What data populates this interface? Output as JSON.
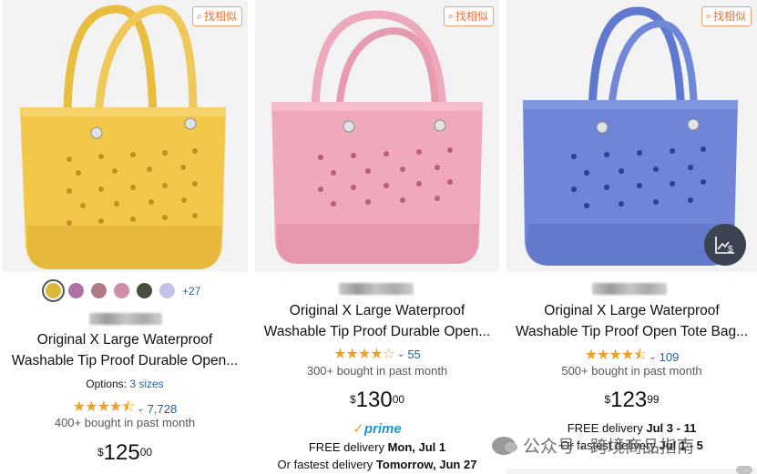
{
  "find_similar_label": "找相似",
  "products": [
    {
      "title_line1": "Original X Large Waterproof",
      "title_line2": "Washable Tip Proof Durable Open...",
      "options_prefix": "Options: ",
      "options_link": "3 sizes",
      "swatch_colors": [
        "#d9b93a",
        "#b071a7",
        "#b07a85",
        "#d48bab",
        "#4a4d3e",
        "#c3c2e8"
      ],
      "swatch_more": "+27",
      "rating_count": "7,728",
      "bought": "400+ bought in past month",
      "price_symbol": "$",
      "price_whole": "125",
      "price_cents": "00",
      "bag_color": "#f2c84b"
    },
    {
      "title_line1": "Original X Large Waterproof",
      "title_line2": "Washable Tip Proof Durable Open...",
      "rating_count": "55",
      "bought": "300+ bought in past month",
      "price_symbol": "$",
      "price_whole": "130",
      "price_cents": "00",
      "prime_label": "prime",
      "delivery_prefix": "FREE delivery ",
      "delivery_date": "Mon, Jul 1",
      "fastest_prefix": "Or fastest delivery ",
      "fastest_date": "Tomorrow, Jun 27",
      "bag_color": "#f0a8bd"
    },
    {
      "title_line1": "Original X Large Waterproof",
      "title_line2": "Washable Tip Proof Open Tote Bag...",
      "rating_count": "109",
      "bought": "500+ bought in past month",
      "price_symbol": "$",
      "price_whole": "123",
      "price_cents": "99",
      "delivery_prefix": "FREE delivery ",
      "delivery_date": "Jul 3 - 11",
      "fastest_prefix": "Or fastest delivery ",
      "fastest_date": "Jul 1 - 5",
      "bag_color": "#6f86d8"
    }
  ],
  "watermark_text": "公众号 · 跨境商品指南",
  "icons": [
    "search-icon",
    "trend-chart-icon",
    "wechat-icon",
    "star-icon",
    "chevron-down-icon"
  ],
  "colors": {
    "link": "#2162a1",
    "star": "#f0a028",
    "prime": "#1a98d5",
    "find_similar": "#e8743b"
  }
}
